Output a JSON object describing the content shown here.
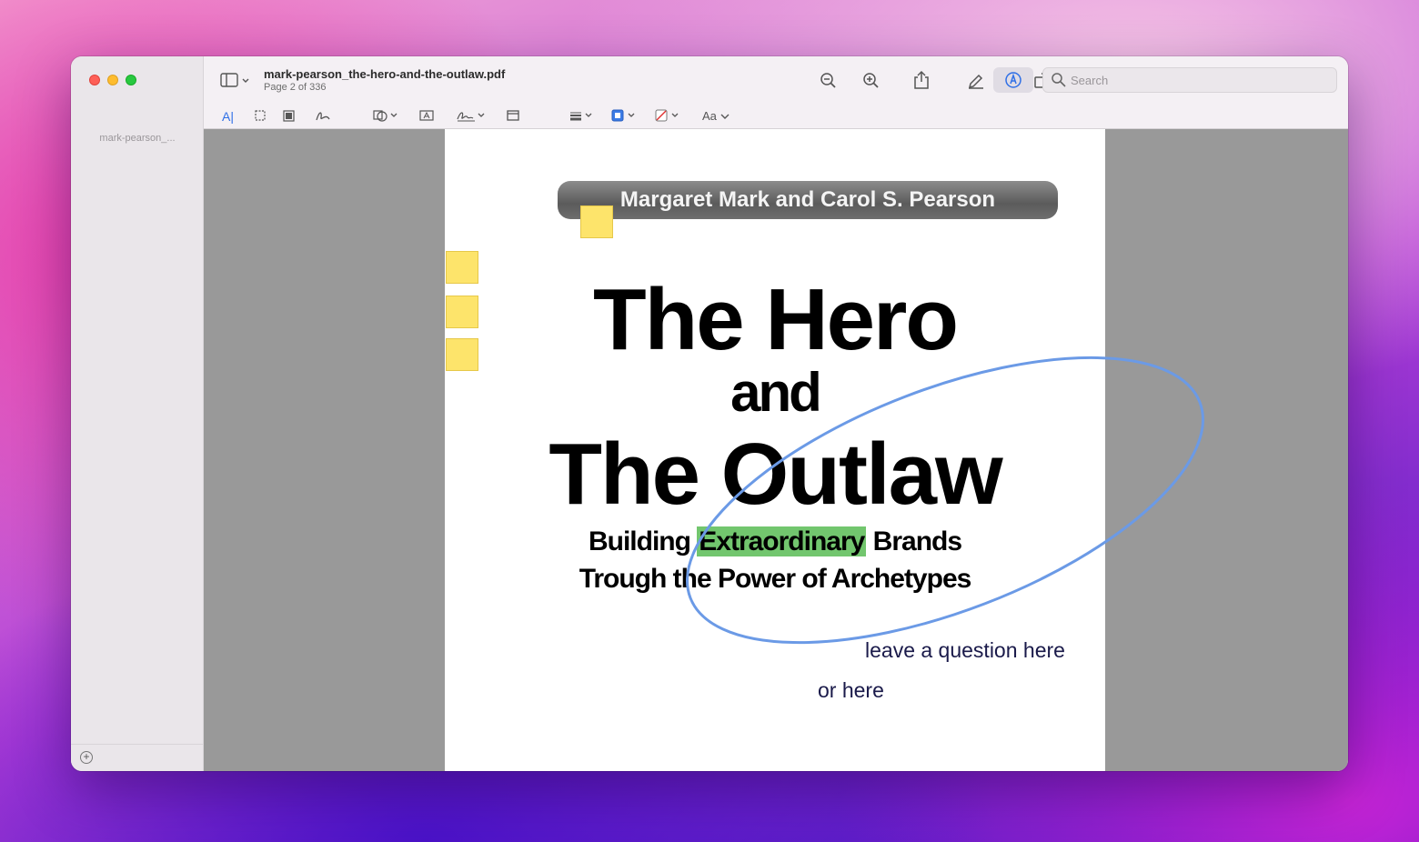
{
  "window": {
    "doc_title": "mark-pearson_the-hero-and-the-outlaw.pdf",
    "page_info": "Page 2 of 336"
  },
  "sidebar": {
    "thumb_label": "mark-pearson_..."
  },
  "search": {
    "placeholder": "Search"
  },
  "markup_toolbar": {
    "text_style_label": "Aa"
  },
  "document": {
    "authors": "Margaret Mark and Carol S. Pearson",
    "title_line1": "The  Hero",
    "title_line2": "and",
    "title_line3": "The  Outlaw",
    "subtitle1_before": "Building ",
    "subtitle1_highlight": "Extraordinary",
    "subtitle1_after": " Brands",
    "subtitle2": "Trough the Power of Archetypes",
    "note1": "leave a question here",
    "note2": "or here"
  },
  "colors": {
    "highlight": "#72c66e",
    "annotation_ellipse": "#6b9ae6",
    "sticky_note": "#fde46b",
    "active_accent": "#2f6fe6"
  }
}
